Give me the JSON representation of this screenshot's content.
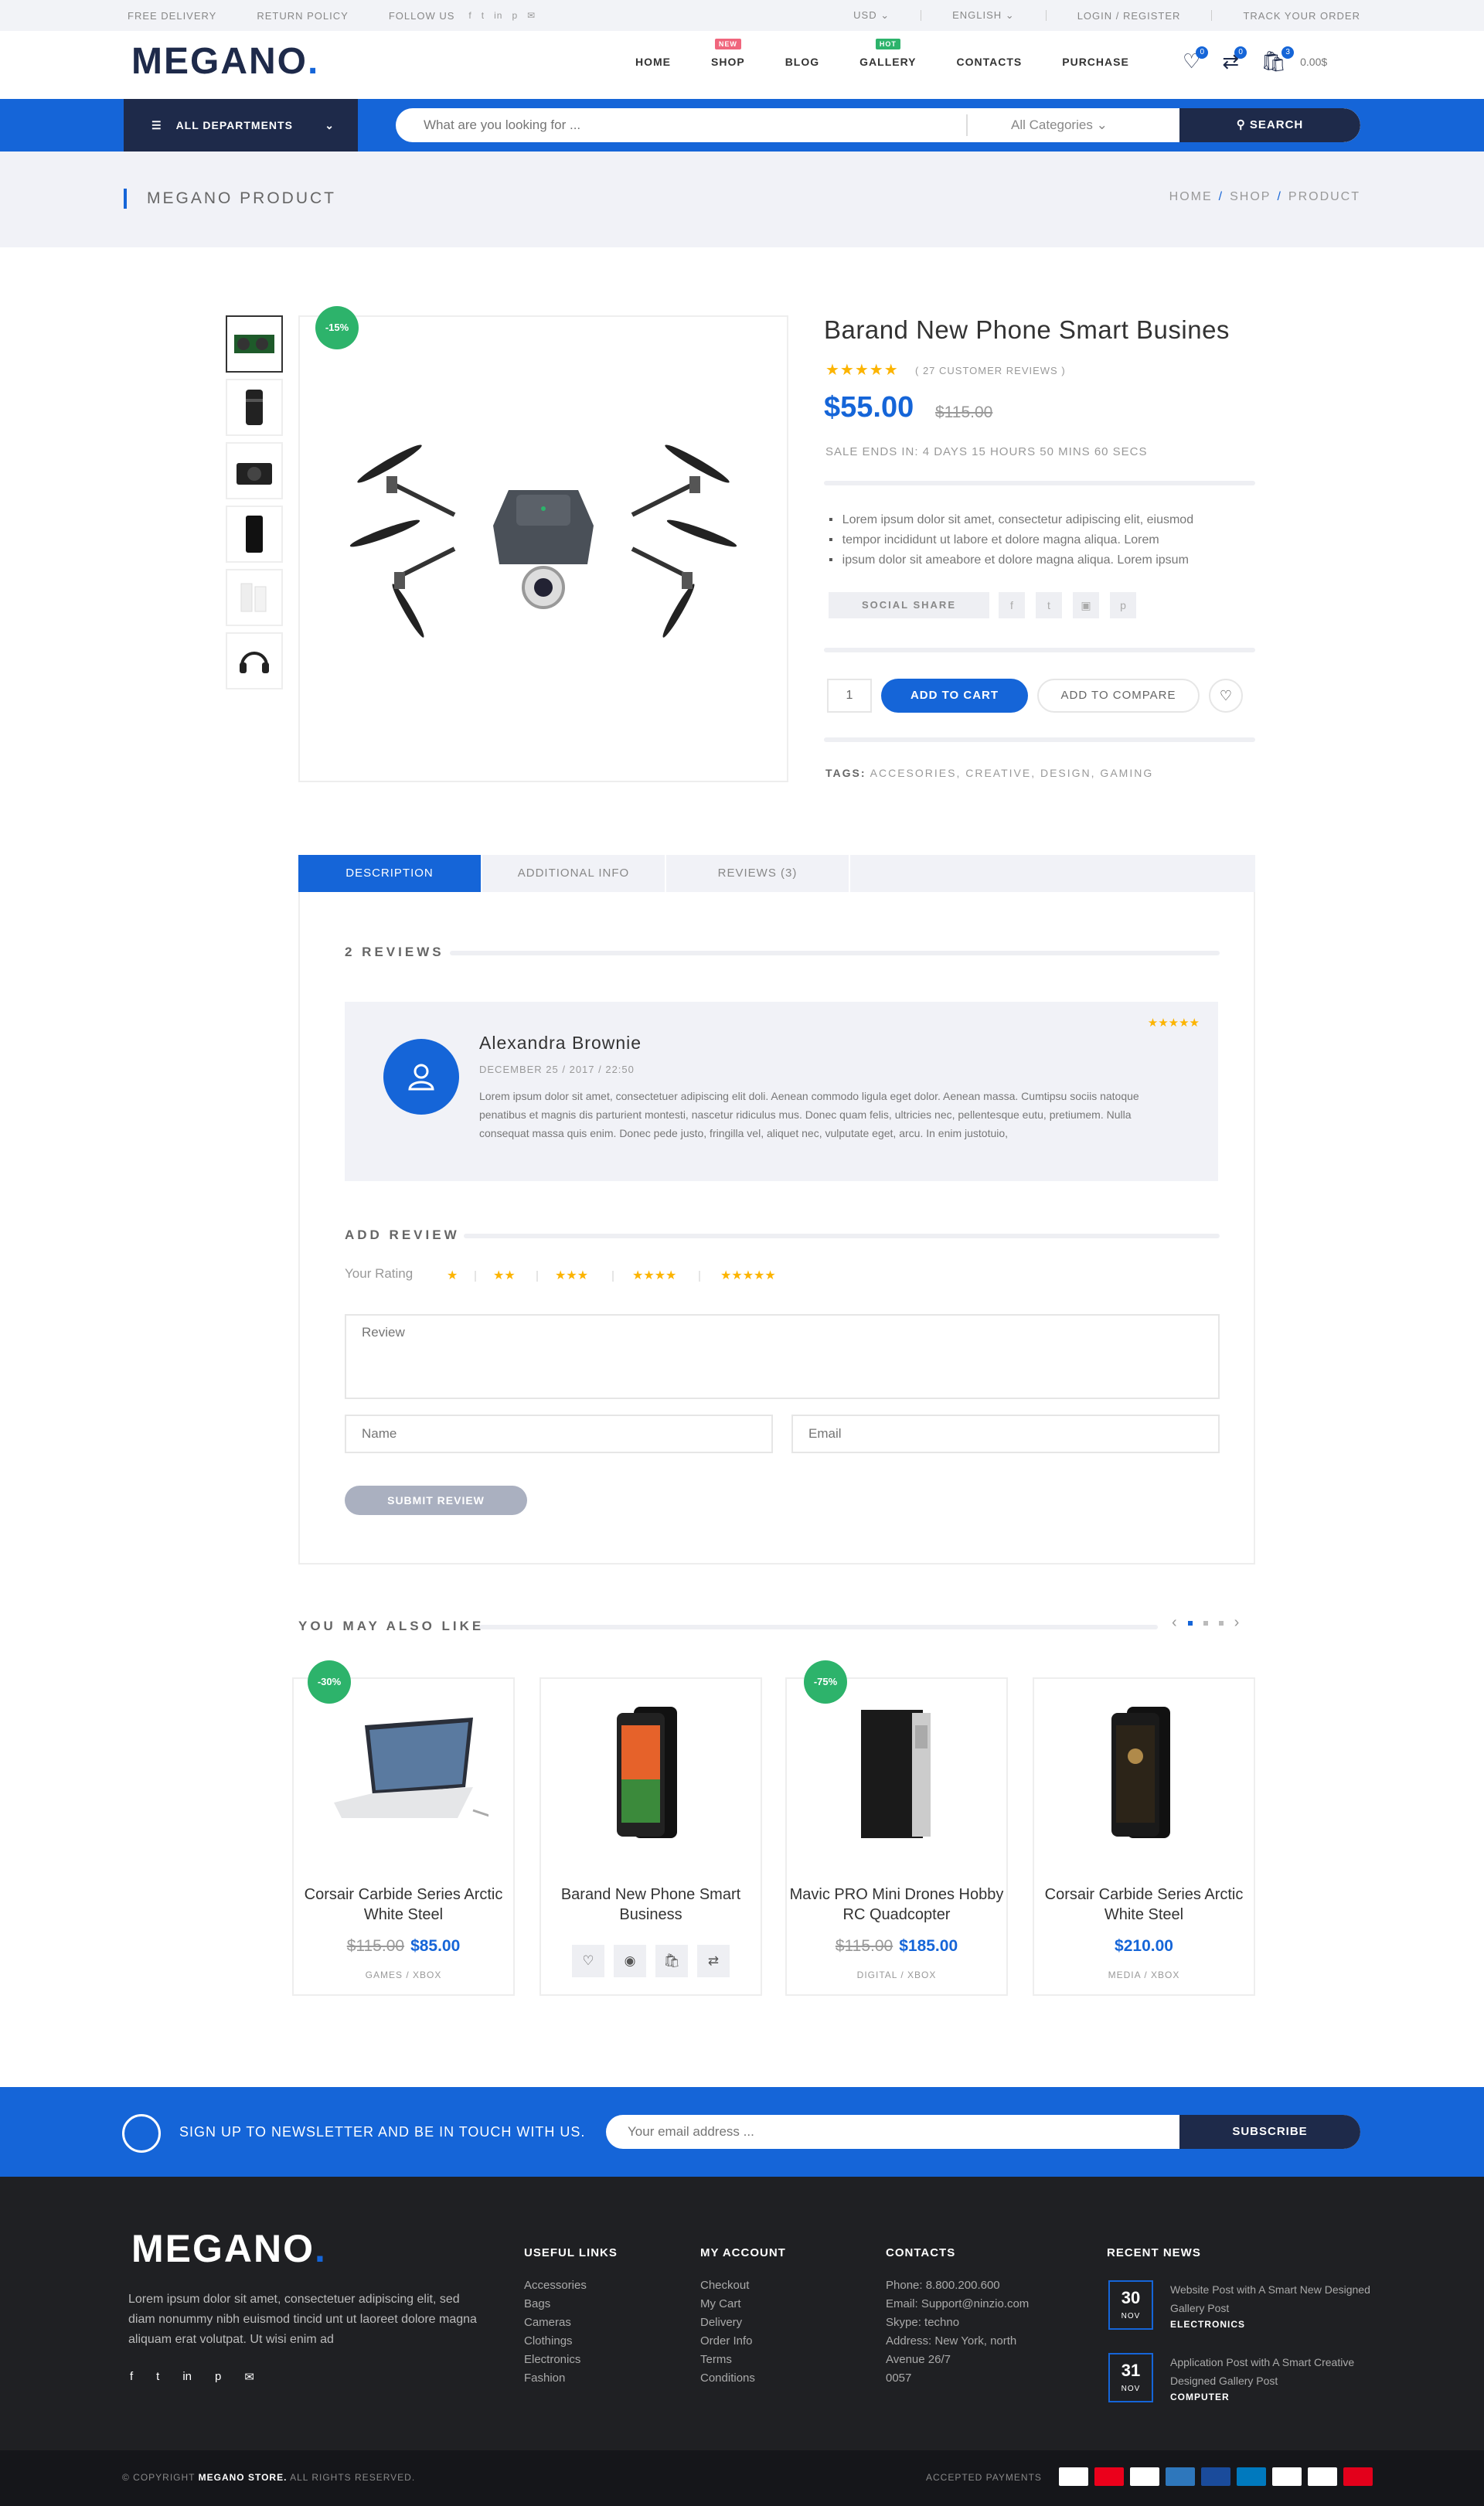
{
  "topbar": {
    "free_delivery": "FREE DELIVERY",
    "return_policy": "RETURN POLICY",
    "follow_us": "FOLLOW US",
    "currency": "USD ⌄",
    "language": "ENGLISH ⌄",
    "login": "LOGIN / REGISTER",
    "track": "TRACK YOUR ORDER"
  },
  "header": {
    "logo_main": "MEGANO",
    "logo_dot": ".",
    "nav": [
      {
        "label": "HOME",
        "badge": ""
      },
      {
        "label": "SHOP",
        "badge": "NEW",
        "badge_color": "#f0667d"
      },
      {
        "label": "BLOG",
        "badge": ""
      },
      {
        "label": "GALLERY",
        "badge": "HOT",
        "badge_color": "#2db36b"
      },
      {
        "label": "CONTACTS",
        "badge": ""
      },
      {
        "label": "PURCHASE",
        "badge": ""
      }
    ],
    "wishlist_count": "0",
    "compare_count": "0",
    "cart_count": "3",
    "cart_total": "0.00$"
  },
  "searchbar": {
    "departments": "ALL DEPARTMENTS",
    "placeholder": "What are you looking for ...",
    "category": "All Categories",
    "button": "SEARCH"
  },
  "breadcrumb": {
    "title": "MEGANO PRODUCT",
    "items": [
      "HOME",
      "SHOP",
      "PRODUCT"
    ]
  },
  "product": {
    "discount": "-15%",
    "title": "Barand New Phone Smart Busines",
    "stars": "★★★★★",
    "reviews": "( 27 CUSTOMER REVIEWS )",
    "price": "$55.00",
    "old_price": "$115.00",
    "sale_ends": "SALE ENDS IN: 4 DAYS 15 HOURS 50 MINS 60 SECS",
    "features": [
      "Lorem ipsum dolor sit amet, consectetur adipiscing elit, eiusmod",
      "tempor incididunt ut labore et dolore magna aliqua. Lorem",
      "ipsum dolor sit ameabore et dolore magna aliqua. Lorem ipsum"
    ],
    "social_share": "SOCIAL SHARE",
    "quantity": "1",
    "add_to_cart": "ADD TO CART",
    "add_to_compare": "ADD TO COMPARE",
    "tags_label": "TAGS:",
    "tags": "ACCESORIES, CREATIVE, DESIGN, GAMING"
  },
  "tabs": [
    "DESCRIPTION",
    "ADDITIONAL INFO",
    "REVIEWS (3)"
  ],
  "reviews": {
    "heading": "2 REVIEWS",
    "name": "Alexandra Brownie",
    "date": "DECEMBER 25  /  2017  /  22:50",
    "stars": "★★★★★",
    "text": "Lorem ipsum dolor sit amet, consectetuer adipiscing elit doli. Aenean commodo ligula eget dolor. Aenean massa. Cumtipsu sociis natoque penatibus et magnis dis parturient montesti, nascetur ridiculus mus. Donec quam felis, ultricies nec, pellentesque eutu, pretiumem. Nulla consequat massa quis enim. Donec pede justo, fringilla vel, aliquet nec, vulputate eget, arcu. In enim justotuio,"
  },
  "add_review": {
    "heading": "ADD REVIEW",
    "your_rating": "Your Rating",
    "options": [
      "★",
      "★★",
      "★★★",
      "★★★★",
      "★★★★★"
    ],
    "review_placeholder": "Review",
    "name_placeholder": "Name",
    "email_placeholder": "Email",
    "submit": "SUBMIT REVIEW"
  },
  "related": {
    "heading": "YOU MAY ALSO LIKE",
    "items": [
      {
        "name": "Corsair Carbide Series Arctic White Steel",
        "old_price": "$115.00",
        "price": "$85.00",
        "category": "GAMES / XBOX",
        "discount": "-30%"
      },
      {
        "name": "Barand New Phone Smart Business",
        "old_price": "",
        "price": "",
        "category": "",
        "discount": ""
      },
      {
        "name": "Mavic PRO Mini Drones Hobby RC Quadcopter",
        "old_price": "$115.00",
        "price": "$185.00",
        "category": "DIGITAL / XBOX",
        "discount": "-75%"
      },
      {
        "name": "Corsair Carbide Series Arctic White Steel",
        "old_price": "",
        "price": "$210.00",
        "category": "MEDIA / XBOX",
        "discount": ""
      }
    ]
  },
  "newsletter": {
    "text": "SIGN UP TO NEWSLETTER AND BE IN TOUCH WITH US.",
    "placeholder": "Your email address ...",
    "button": "SUBSCRIBE"
  },
  "footer": {
    "about": "Lorem ipsum dolor sit amet, consectetuer adipiscing elit, sed diam nonummy nibh euismod tincid  unt ut laoreet dolore magna aliquam erat volutpat. Ut wisi enim ad",
    "useful_links": {
      "title": "USEFUL LINKS",
      "items": [
        "Accessories",
        "Bags",
        "Cameras",
        "Clothings",
        "Electronics",
        "Fashion"
      ]
    },
    "my_account": {
      "title": "MY ACCOUNT",
      "items": [
        "Checkout",
        "My Cart",
        "Delivery",
        "Order Info",
        "Terms",
        "Conditions"
      ]
    },
    "contacts": {
      "title": "CONTACTS",
      "items": [
        "Phone: 8.800.200.600",
        "Email: Support@ninzio.com",
        "Skype: techno",
        "Address: New York, north",
        "Avenue 26/7",
        "0057"
      ]
    },
    "recent_news": {
      "title": "RECENT NEWS",
      "items": [
        {
          "day": "30",
          "month": "NOV",
          "text": "Website Post with A Smart New Designed Gallery Post",
          "tag": "ELECTRONICS"
        },
        {
          "day": "31",
          "month": "NOV",
          "text": "Application Post with A Smart Creative Designed Gallery Post",
          "tag": "COMPUTER"
        }
      ]
    },
    "copyright_pre": "© COPYRIGHT",
    "copyright_brand": "MEGANO STORE.",
    "copyright_post": "ALL RIGHTS RESERVED.",
    "accepted_payments": "ACCEPTED PAYMENTS"
  },
  "colors": {
    "accent": "#1565d8",
    "dark": "#1e2a4a",
    "green": "#2db36b",
    "star": "#fcb400"
  }
}
